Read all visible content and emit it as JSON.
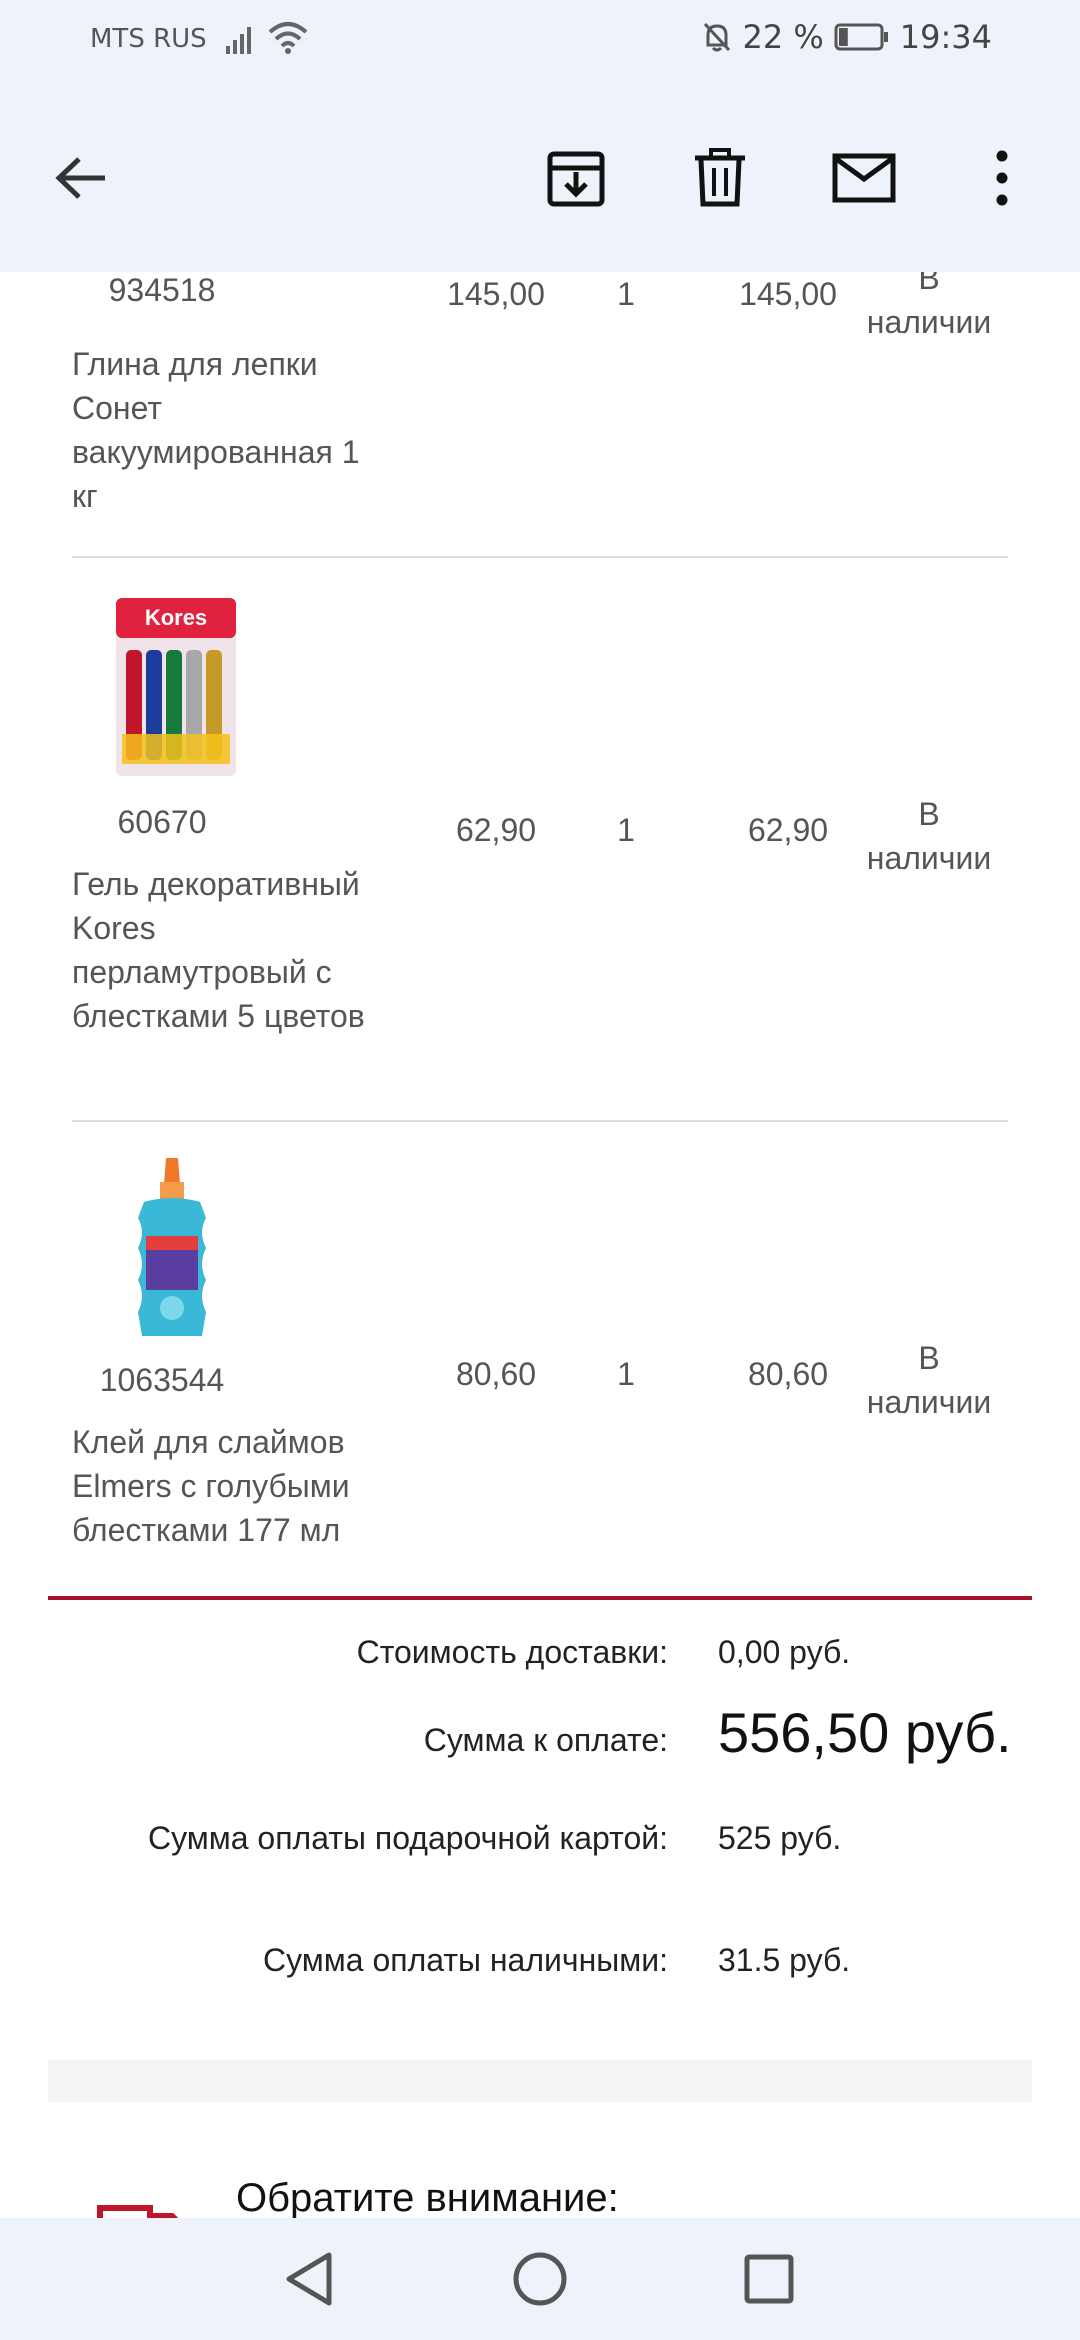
{
  "status_bar": {
    "carrier": "MTS RUS",
    "battery_text": "22 %",
    "time": "19:34",
    "battery_level": 0.22
  },
  "toolbar": {
    "icons": [
      "back-arrow-icon",
      "archive-icon",
      "delete-icon",
      "mail-icon",
      "more-vert-icon"
    ]
  },
  "items": [
    {
      "sku": "934518",
      "name": "Глина для лепки Сонет вакуумированная 1 кг",
      "price": "145,00",
      "qty": "1",
      "total": "145,00",
      "availability": "В наличии"
    },
    {
      "sku": "60670",
      "name": "Гель декоративный Kores перламутровый с блестками 5 цветов",
      "price": "62,90",
      "qty": "1",
      "total": "62,90",
      "availability": "В наличии",
      "image_text": "Kores"
    },
    {
      "sku": "1063544",
      "name": "Клей для слаймов Elmers с голубыми блестками 177 мл",
      "price": "80,60",
      "qty": "1",
      "total": "80,60",
      "availability": "В наличии"
    }
  ],
  "summary": {
    "delivery_label": "Стоимость доставки:",
    "delivery_value": "0,00 руб.",
    "total_label": "Сумма к оплате:",
    "total_value": "556,50 руб.",
    "gift_label": "Сумма оплаты подарочной картой:",
    "gift_value": "525 руб.",
    "cash_label": "Сумма оплаты наличными:",
    "cash_value": "31.5 руб."
  },
  "notice": {
    "title": "Обратите внимание:"
  },
  "nav": {
    "icons": [
      "nav-back-icon",
      "nav-home-icon",
      "nav-recents-icon"
    ]
  },
  "colors": {
    "bar_bg": "#eef2fb",
    "accent_rule": "#a5122e",
    "divider": "#dcdcdc",
    "text": "#555555"
  }
}
